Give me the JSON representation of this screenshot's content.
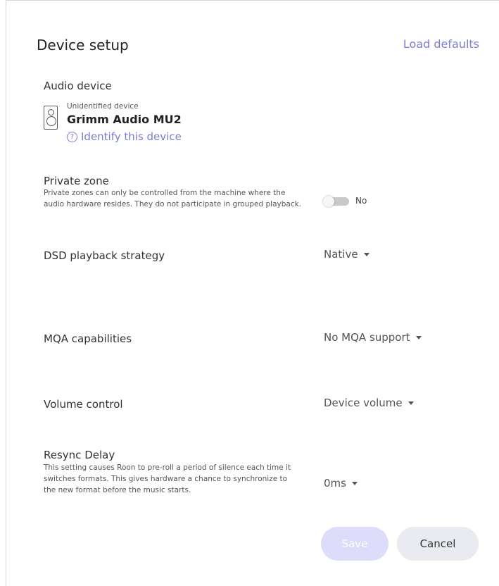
{
  "dialog": {
    "title": "Device setup",
    "load_defaults": "Load defaults"
  },
  "audio_device": {
    "label": "Audio device",
    "status": "Unidentified device",
    "name": "Grimm Audio MU2",
    "identify_link": "Identify this device",
    "icon": "speaker-icon"
  },
  "private_zone": {
    "label": "Private zone",
    "description": "Private zones can only be controlled from the machine where the audio hardware resides. They do not participate in grouped playback.",
    "value_label": "No",
    "enabled": false
  },
  "dsd": {
    "label": "DSD playback strategy",
    "value": "Native"
  },
  "mqa": {
    "label": "MQA capabilities",
    "value": "No MQA support"
  },
  "volume": {
    "label": "Volume control",
    "value": "Device volume"
  },
  "resync": {
    "label": "Resync Delay",
    "description": "This setting causes Roon to pre-roll a period of silence each time it switches formats. This gives hardware a chance to synchronize to the new format before the music starts.",
    "value": "0ms"
  },
  "actions": {
    "save": "Save",
    "cancel": "Cancel"
  },
  "colors": {
    "accent": "#7b7bd6",
    "save_disabled_bg": "#dddcfb",
    "cancel_bg": "#e9ebf1"
  }
}
